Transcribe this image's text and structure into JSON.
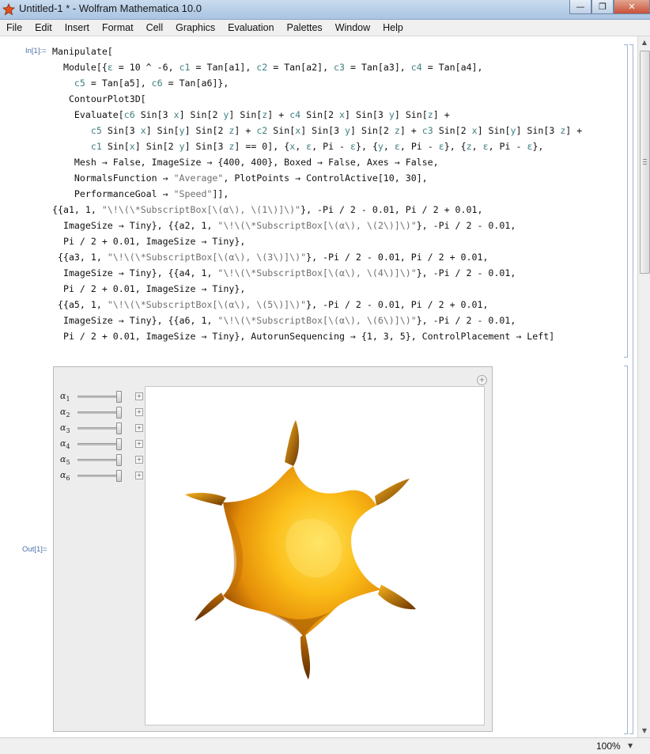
{
  "window": {
    "title": "Untitled-1 * - Wolfram Mathematica 10.0",
    "minimize_glyph": "—",
    "maximize_glyph": "❐",
    "close_glyph": "✕"
  },
  "menu": [
    "File",
    "Edit",
    "Insert",
    "Format",
    "Cell",
    "Graphics",
    "Evaluation",
    "Palettes",
    "Window",
    "Help"
  ],
  "cell": {
    "in_label": "In[1]:=",
    "out_label": "Out[1]="
  },
  "sliders": [
    {
      "label": "α",
      "index": "1",
      "value": 1
    },
    {
      "label": "α",
      "index": "2",
      "value": 1
    },
    {
      "label": "α",
      "index": "3",
      "value": 1
    },
    {
      "label": "α",
      "index": "4",
      "value": 1
    },
    {
      "label": "α",
      "index": "5",
      "value": 1
    },
    {
      "label": "α",
      "index": "6",
      "value": 1
    }
  ],
  "slider_plus_glyph": "+",
  "add_glyph": "+",
  "status": {
    "zoom": "100%"
  },
  "colors": {
    "surface_light": "#ffd027",
    "surface_mid": "#f1a30c",
    "surface_dark": "#7a3a03",
    "label_blue": "#4d6fa8",
    "variable_teal": "#3f7f7f"
  }
}
